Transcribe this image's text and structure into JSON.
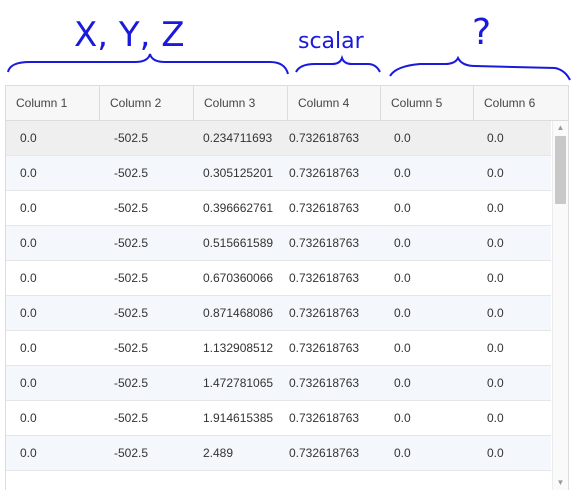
{
  "annotations": {
    "xyz": "X, Y, Z",
    "scalar": "scalar",
    "unknown": "?"
  },
  "table": {
    "columns": [
      "Column 1",
      "Column 2",
      "Column 3",
      "Column 4",
      "Column 5",
      "Column 6"
    ],
    "rows": [
      [
        "0.0",
        "-502.5",
        "0.234711693",
        "0.732618763",
        "0.0",
        "0.0"
      ],
      [
        "0.0",
        "-502.5",
        "0.305125201",
        "0.732618763",
        "0.0",
        "0.0"
      ],
      [
        "0.0",
        "-502.5",
        "0.396662761",
        "0.732618763",
        "0.0",
        "0.0"
      ],
      [
        "0.0",
        "-502.5",
        "0.515661589",
        "0.732618763",
        "0.0",
        "0.0"
      ],
      [
        "0.0",
        "-502.5",
        "0.670360066",
        "0.732618763",
        "0.0",
        "0.0"
      ],
      [
        "0.0",
        "-502.5",
        "0.871468086",
        "0.732618763",
        "0.0",
        "0.0"
      ],
      [
        "0.0",
        "-502.5",
        "1.132908512",
        "0.732618763",
        "0.0",
        "0.0"
      ],
      [
        "0.0",
        "-502.5",
        "1.472781065",
        "0.732618763",
        "0.0",
        "0.0"
      ],
      [
        "0.0",
        "-502.5",
        "1.914615385",
        "0.732618763",
        "0.0",
        "0.0"
      ],
      [
        "0.0",
        "-502.5",
        "2.489",
        "0.732618763",
        "0.0",
        "0.0"
      ],
      [
        "",
        "",
        "",
        "",
        "",
        ""
      ]
    ]
  },
  "icons": {
    "scroll_up": "up-arrow-icon",
    "scroll_down": "down-arrow-icon"
  },
  "colors": {
    "annotation_ink": "#1a1adc"
  }
}
